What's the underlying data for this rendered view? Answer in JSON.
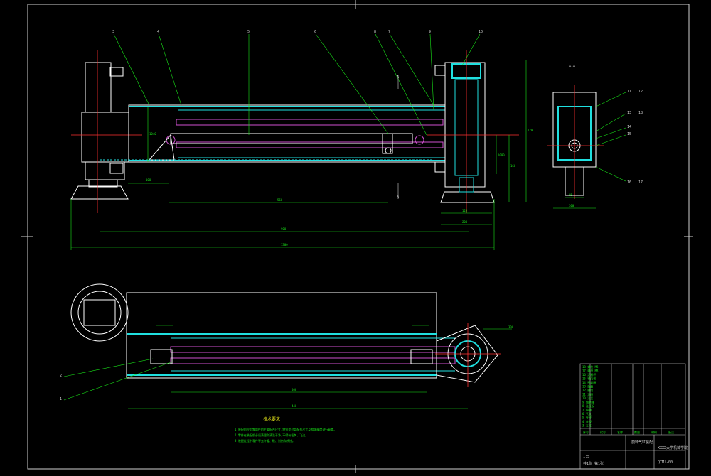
{
  "drawing": {
    "callouts": [
      "3",
      "4",
      "5",
      "6",
      "8",
      "7",
      "9",
      "10",
      "11",
      "12",
      "13",
      "14",
      "15",
      "16",
      "17",
      "18"
    ],
    "section_mark": "A",
    "section_view_label": "A-A",
    "dims": {
      "d1": "100",
      "d2": "560",
      "d3": "900",
      "d4": "1300",
      "d5": "460",
      "d6": "440",
      "d7": "125",
      "d8": "200",
      "d9": "170",
      "d10": "160",
      "d11": "1000",
      "d12": "1040",
      "d13": "95",
      "d14": "300"
    },
    "plan_callouts": [
      "2",
      "1",
      "300"
    ]
  },
  "notes": {
    "title": "技术要求",
    "lines": [
      "1.装配前应对零部件的主要配合尺寸,特别是过盈配合尺寸及相关精度进行复查。",
      "2.零件在装配前必须清理和清洗干净,不得有毛刺、飞边。",
      "3.装配过程中零件不允许磕、碰、划伤和锈蚀。"
    ]
  },
  "title_block": {
    "name": "旋转气缸装配",
    "company": "XXXX大学机械学院",
    "drawing_no": "QTMJ-00",
    "scale": "1:5",
    "sheet": "共1张 第1张",
    "parts_rows": [
      "18 螺栓 M8",
      "17 螺母 M8",
      "16 活塞杆",
      "15 导向套",
      "14 密封圈",
      "13 端盖",
      "12 缸筒",
      "11 支座",
      "10 法兰",
      "9 轴承座",
      "8 连接板",
      "7 销轴",
      "6 气缸",
      "5 导杆",
      "4 底板",
      "3 立柱"
    ],
    "headers": [
      "序号",
      "代号",
      "名称",
      "数量",
      "材料",
      "备注"
    ]
  }
}
